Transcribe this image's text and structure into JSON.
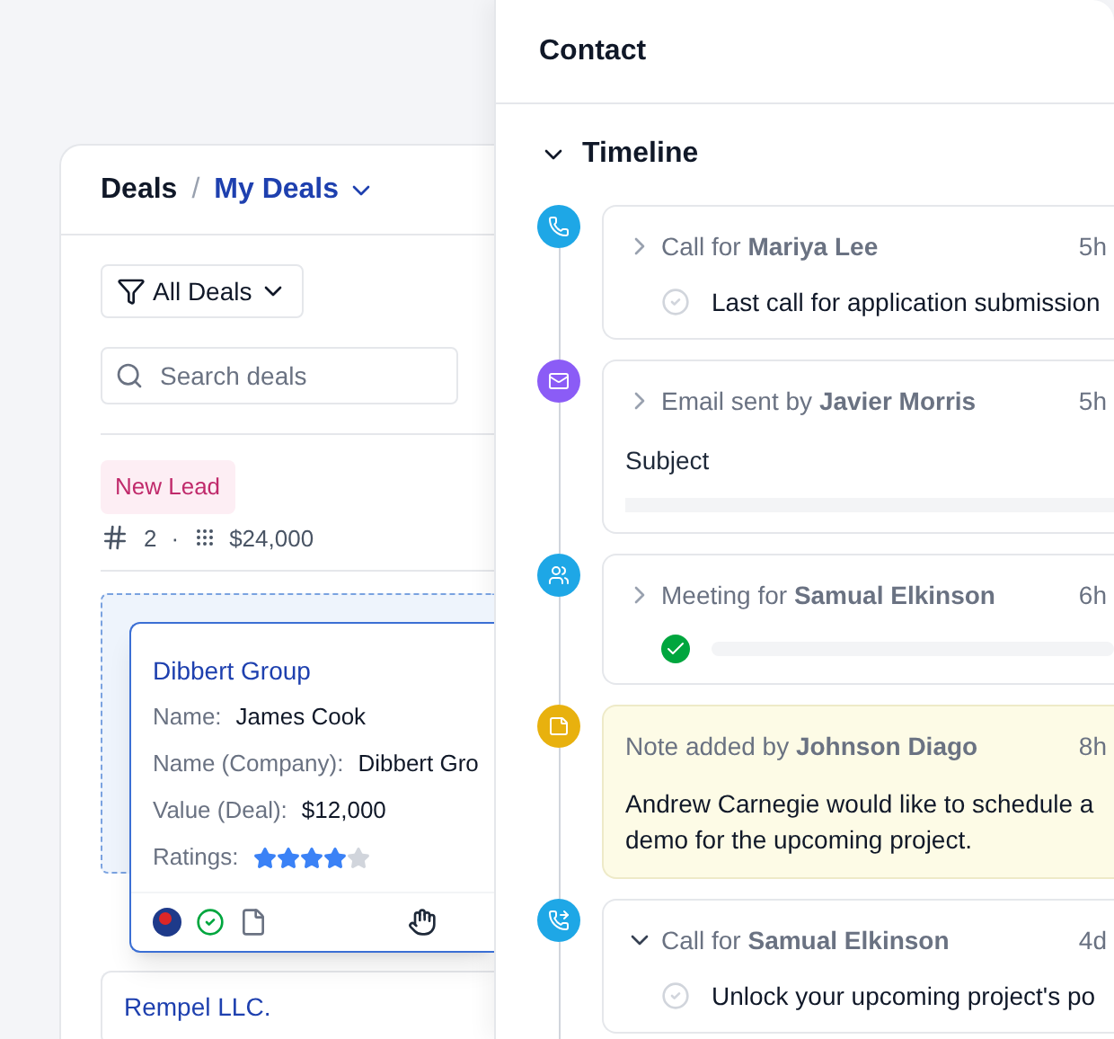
{
  "deals_panel": {
    "title": "Deals",
    "separator": "/",
    "view": "My Deals",
    "filter": "All Deals",
    "search": {
      "placeholder": "Search deals"
    },
    "stage": {
      "label": "New Lead",
      "color": "#c02a6b",
      "count": "2",
      "dot": "·",
      "total": "$24,000"
    },
    "cards": [
      {
        "title": "Dibbert Group",
        "dragging": true,
        "fields": [
          {
            "label": "Name:",
            "value": "James Cook"
          },
          {
            "label": "Name (Company):",
            "value": "Dibbert Gro"
          },
          {
            "label": "Value (Deal):",
            "value": "$12,000"
          }
        ],
        "rating_label": "Ratings:",
        "stars": 4
      },
      {
        "title": "Rempel LLC.",
        "dragging": false
      }
    ]
  },
  "contact_panel": {
    "title": "Contact",
    "section": {
      "label": "Timeline",
      "expanded": true
    },
    "timeline": [
      {
        "kind": "call",
        "color": "#1ea7e6",
        "title": "Call for **Mariya Lee**",
        "time": "5h",
        "expanded": false,
        "done": false,
        "body": "Last call for application submission"
      },
      {
        "kind": "email",
        "color": "#8b5cf6",
        "title": "Email sent by **Javier Morris**",
        "time": "5h",
        "expanded": false,
        "body": "Subject"
      },
      {
        "kind": "meeting",
        "color": "#1ea7e6",
        "title": "Meeting for **Samual Elkinson**",
        "time": "6h",
        "expanded": false,
        "done": true
      },
      {
        "kind": "note",
        "color": "#e8b10e",
        "title": "Note added by **Johnson Diago**",
        "time": "8h",
        "body": "Andrew Carnegie would like to schedule a demo for the upcoming project."
      },
      {
        "kind": "call",
        "color": "#1ea7e6",
        "title": "Call for **Samual Elkinson**",
        "time": "4d",
        "expanded": true,
        "done": false,
        "body": "Unlock your upcoming project's po"
      }
    ]
  }
}
